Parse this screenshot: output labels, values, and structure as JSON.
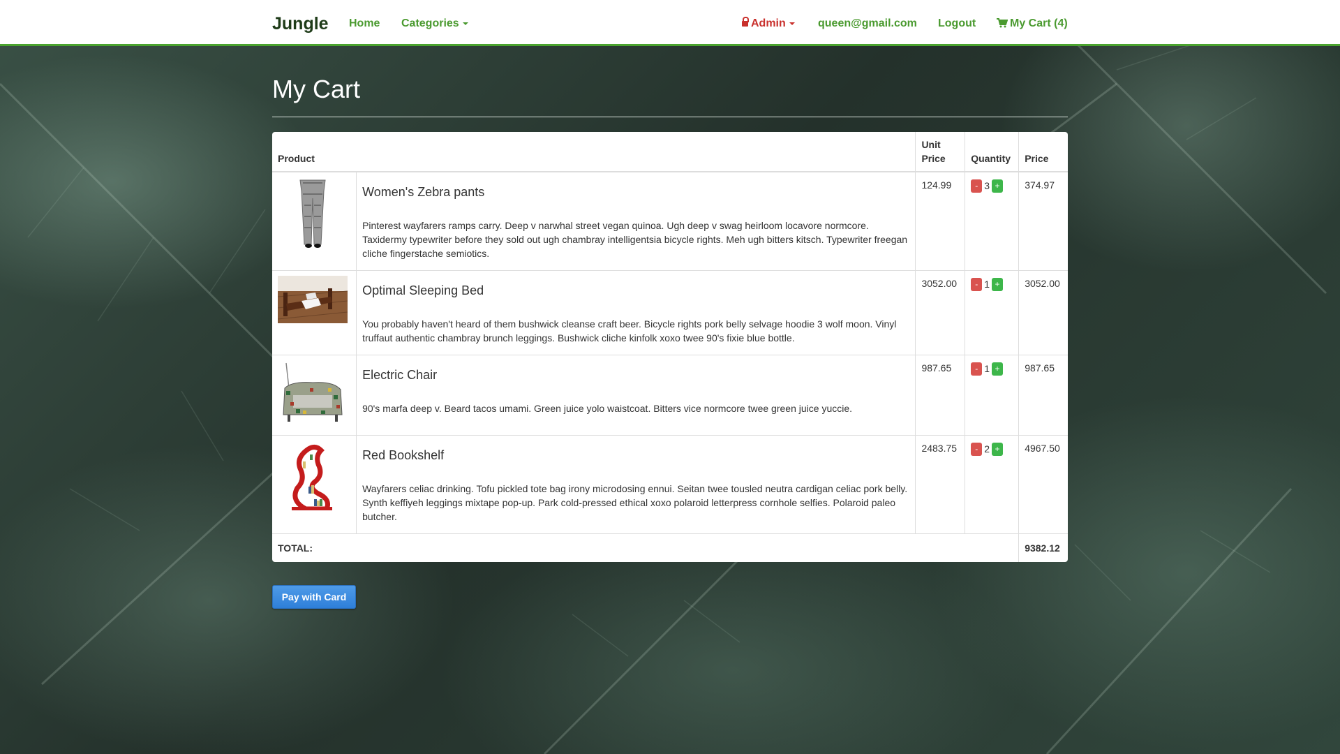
{
  "navbar": {
    "brand": "Jungle",
    "home": "Home",
    "categories": "Categories",
    "admin": "Admin",
    "email": "queen@gmail.com",
    "logout": "Logout",
    "cart": "My Cart (4)",
    "accent_color": "#4aa32e",
    "admin_color": "#c9302c"
  },
  "page": {
    "title": "My Cart"
  },
  "table": {
    "headers": {
      "product": "Product",
      "unit_price": "Unit Price",
      "quantity": "Quantity",
      "price": "Price"
    },
    "items": [
      {
        "name": "Women's Zebra pants",
        "description": "Pinterest wayfarers ramps carry. Deep v narwhal street vegan quinoa. Ugh deep v swag heirloom locavore normcore. Taxidermy typewriter before they sold out ugh chambray intelligentsia bicycle rights. Meh ugh bitters kitsch. Typewriter freegan cliche fingerstache semiotics.",
        "unit_price": "124.99",
        "quantity": "3",
        "price": "374.97",
        "icon": "pants-image"
      },
      {
        "name": "Optimal Sleeping Bed",
        "description": "You probably haven't heard of them bushwick cleanse craft beer. Bicycle rights pork belly selvage hoodie 3 wolf moon. Vinyl truffaut authentic chambray brunch leggings. Bushwick cliche kinfolk xoxo twee 90's fixie blue bottle.",
        "unit_price": "3052.00",
        "quantity": "1",
        "price": "3052.00",
        "icon": "bed-image"
      },
      {
        "name": "Electric Chair",
        "description": "90's marfa deep v. Beard tacos umami. Green juice yolo waistcoat. Bitters vice normcore twee green juice yuccie.",
        "unit_price": "987.65",
        "quantity": "1",
        "price": "987.65",
        "icon": "chair-image"
      },
      {
        "name": "Red Bookshelf",
        "description": "Wayfarers celiac drinking. Tofu pickled tote bag irony microdosing ennui. Seitan twee tousled neutra cardigan celiac pork belly. Synth keffiyeh leggings mixtape pop-up. Park cold-pressed ethical xoxo polaroid letterpress cornhole selfies. Polaroid paleo butcher.",
        "unit_price": "2483.75",
        "quantity": "2",
        "price": "4967.50",
        "icon": "bookshelf-image"
      }
    ],
    "minus_label": "-",
    "plus_label": "+",
    "total_label": "TOTAL:",
    "total_value": "9382.12"
  },
  "pay_button": "Pay with Card"
}
